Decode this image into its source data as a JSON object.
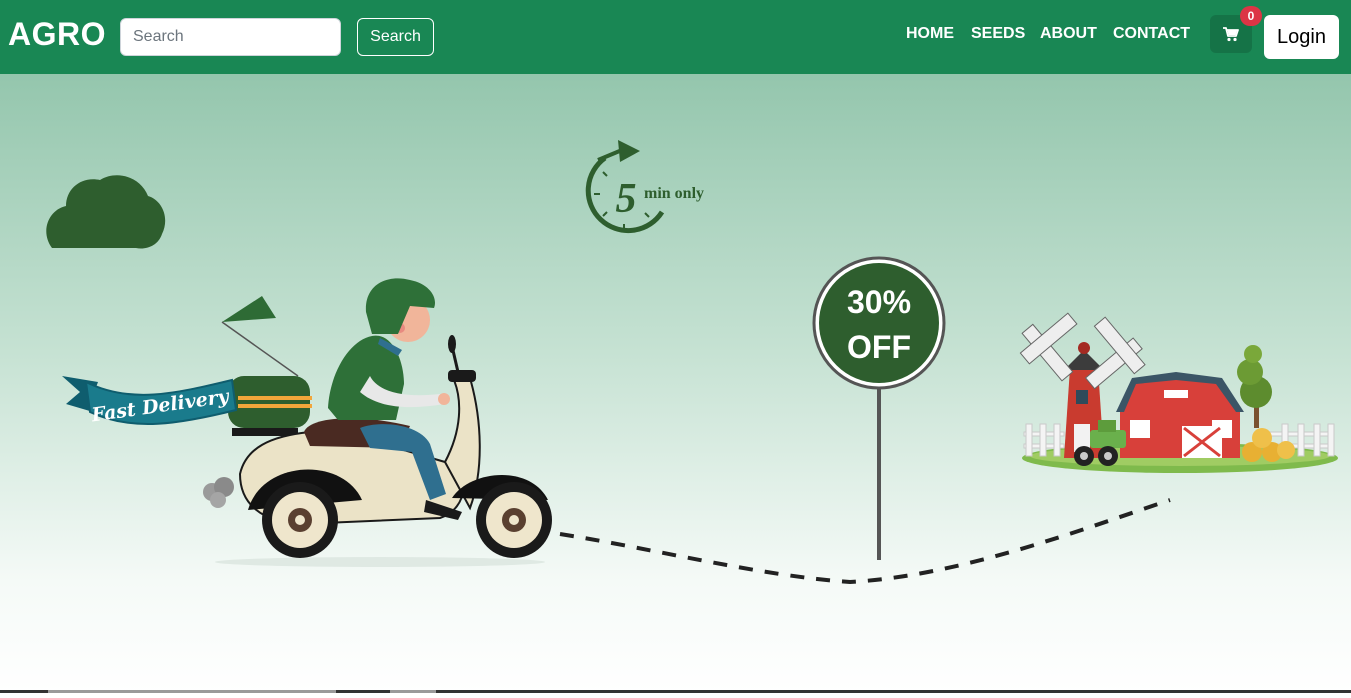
{
  "navbar": {
    "brand": "AGRO",
    "search": {
      "placeholder": "Search",
      "value": "",
      "button_label": "Search"
    },
    "links": [
      "HOME",
      "SEEDS",
      "ABOUT",
      "CONTACT"
    ],
    "cart": {
      "icon": "cart-icon",
      "count": "0"
    },
    "login_label": "Login"
  },
  "hero": {
    "banner_text": "Fast Delivery",
    "timer": {
      "number": "5",
      "label": "min only"
    },
    "offer": {
      "line1": "30%",
      "line2": "OFF"
    }
  },
  "colors": {
    "navbar": "#198754",
    "badge": "#dc3545",
    "hero_top": "#94c6ad",
    "dark_green": "#2e5e2e"
  }
}
